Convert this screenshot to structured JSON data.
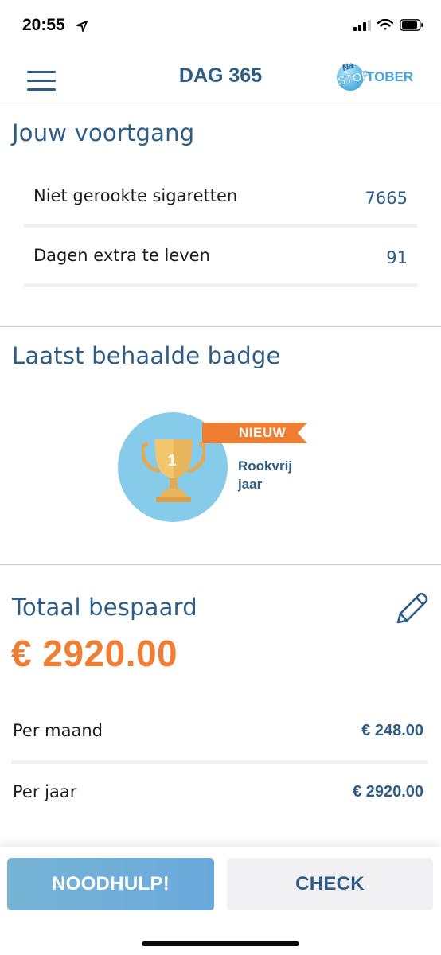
{
  "status_bar": {
    "time": "20:55",
    "icons": [
      "location-arrow-icon",
      "signal-bars-icon",
      "wifi-icon",
      "battery-icon"
    ]
  },
  "header": {
    "title": "DAG 365",
    "logo": {
      "line1": "Na",
      "line2": "STOP",
      "line3": "TOBER"
    },
    "menu_icon": "hamburger-menu-icon"
  },
  "progress": {
    "title": "Jouw voortgang",
    "rows": [
      {
        "label": "Niet gerookte sigaretten",
        "value": "7665"
      },
      {
        "label": "Dagen extra te leven",
        "value": "91"
      }
    ]
  },
  "badge": {
    "title": "Laatst behaalde badge",
    "number": "1",
    "ribbon": "NIEUW",
    "name_line1": "Rookvrij",
    "name_line2": "jaar",
    "icon": "trophy-icon"
  },
  "savings": {
    "title": "Totaal bespaard",
    "total": "€ 2920.00",
    "edit_icon": "pencil-icon",
    "rows": [
      {
        "label": "Per maand",
        "value": "€ 248.00"
      },
      {
        "label": "Per jaar",
        "value": "€ 2920.00"
      }
    ]
  },
  "bottom": {
    "help_label": "NOODHULP!",
    "check_label": "CHECK"
  },
  "colors": {
    "primary": "#2d5d86",
    "accent": "#ef7d32",
    "badge_bg": "#86cbea",
    "help_button": "#6fafd8"
  }
}
